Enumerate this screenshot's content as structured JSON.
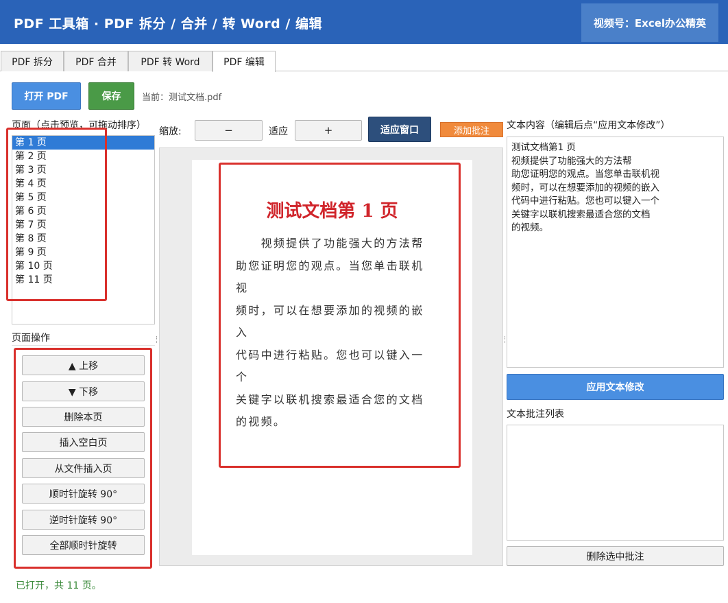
{
  "window": {
    "title": "PDF 工具箱 · PDF 拆分 / 合并 / 转 Word / 编辑",
    "channel": "视频号：Excel办公精英"
  },
  "tabs": [
    {
      "label": "PDF 拆分",
      "active": false
    },
    {
      "label": "PDF 合并",
      "active": false
    },
    {
      "label": "PDF 转 Word",
      "active": false
    },
    {
      "label": "PDF 编辑",
      "active": true
    }
  ],
  "toolbar": {
    "open_label": "打开 PDF",
    "save_label": "保存",
    "current_file": "当前：测试文档.pdf"
  },
  "pages_panel": {
    "label": "页面（点击预览，可拖动排序）",
    "items": [
      "第 1 页",
      "第 2 页",
      "第 3 页",
      "第 4 页",
      "第 5 页",
      "第 6 页",
      "第 7 页",
      "第 8 页",
      "第 9 页",
      "第 10 页",
      "第 11 页"
    ],
    "selected_index": 0
  },
  "ops_panel": {
    "label": "页面操作",
    "buttons": [
      "▲ 上移",
      "▼ 下移",
      "删除本页",
      "插入空白页",
      "从文件插入页",
      "顺时针旋转 90°",
      "逆时针旋转 90°",
      "全部顺时针旋转"
    ]
  },
  "status": "已打开，共 11 页。",
  "zoom": {
    "label": "缩放:",
    "minus": "−",
    "fit_label": "适应",
    "plus": "+",
    "fit_window": "适应窗口",
    "add_annotation": "添加批注"
  },
  "preview": {
    "title": "测试文档第 1 页",
    "body_lines": [
      "　　视频提供了功能强大的方法帮",
      "助您证明您的观点。当您单击联机视",
      "频时，可以在想要添加的视频的嵌入",
      "代码中进行粘贴。您也可以键入一个",
      "关键字以联机搜索最适合您的文档",
      "的视频。"
    ]
  },
  "text_panel": {
    "label": "文本内容（编辑后点“应用文本修改”）",
    "lines": [
      "测试文档第1 页",
      "视频提供了功能强大的方法帮",
      "助您证明您的观点。当您单击联机视",
      "频时，可以在想要添加的视频的嵌入",
      "代码中进行粘贴。您也可以键入一个",
      "关键字以联机搜索最适合您的文档",
      "的视频。"
    ],
    "apply_label": "应用文本修改",
    "annotations_label": "文本批注列表",
    "delete_annotation_label": "删除选中批注"
  },
  "colors": {
    "title_bar": "#2a63b8",
    "primary_button": "#4a8fe1",
    "save_button": "#4a9a47",
    "fit_button": "#2d4f7c",
    "annotation_button": "#f08a3c",
    "highlight": "#d9302c",
    "doc_title": "#d0242a",
    "status_text": "#3b8a3b"
  }
}
